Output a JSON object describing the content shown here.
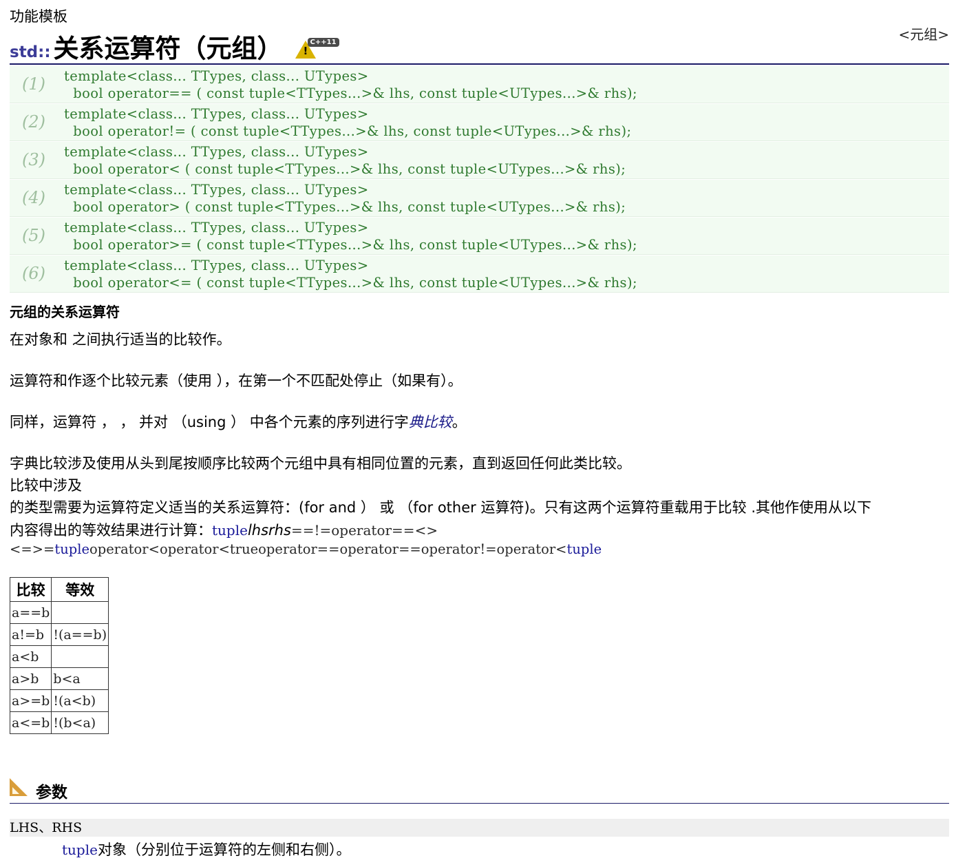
{
  "header": {
    "kind": "功能模板",
    "namespace": "std::",
    "name": "关系运算符（元组）",
    "badge": "C++11",
    "link": "<元组>"
  },
  "declarations": [
    {
      "num": "(1)",
      "line1": "template<class... TTypes, class... UTypes>",
      "line2": "  bool operator== ( const tuple<TTypes...>& lhs, const tuple<UTypes...>& rhs);"
    },
    {
      "num": "(2)",
      "line1": "template<class... TTypes, class... UTypes>",
      "line2": "  bool operator!= ( const tuple<TTypes...>& lhs, const tuple<UTypes...>& rhs);"
    },
    {
      "num": "(3)",
      "line1": "template<class... TTypes, class... UTypes>",
      "line2": "  bool operator< ( const tuple<TTypes...>& lhs, const tuple<UTypes...>& rhs);"
    },
    {
      "num": "(4)",
      "line1": "template<class... TTypes, class... UTypes>",
      "line2": "  bool operator> ( const tuple<TTypes...>& lhs, const tuple<UTypes...>& rhs);"
    },
    {
      "num": "(5)",
      "line1": "template<class... TTypes, class... UTypes>",
      "line2": "  bool operator>= ( const tuple<TTypes...>& lhs, const tuple<UTypes...>& rhs);"
    },
    {
      "num": "(6)",
      "line1": "template<class... TTypes, class... UTypes>",
      "line2": "  bool operator<= ( const tuple<TTypes...>& lhs, const tuple<UTypes...>& rhs);"
    }
  ],
  "description": {
    "heading": "元组的关系运算符",
    "p1": "在对象和 之间执行适当的比较作。",
    "p2": "运算符和作逐个比较元素（使用 ），在第一个不匹配处停止（如果有）。",
    "p3_before": "同样，运算符 ， ， 并对 （using ） 中各个元素的序列进行字",
    "p3_link": "典比较",
    "p3_after": "。",
    "p4": "字典比较涉及使用从头到尾按顺序比较两个元组中具有相同位置的元素，直到返回任何此类比较。",
    "p5": "比较中涉及",
    "p6": "的类型需要为运算符定义适当的关系运算符：(for and ） 或 （for other 运算符)。只有这两个运算符重载用于比较 .其他作使用从以下",
    "p7_text": "内容得出的等效结果进行计算：",
    "p7_kw": "tuple",
    "p7_italic": "lhsrhs",
    "p7_tail": "==!=operator==<>",
    "p8_a": "<=>=",
    "p8_kw1": "tuple",
    "p8_b": "operator<operator<",
    "p8_c": "trueoperator==operator==operator!=operator<",
    "p8_kw2": "tuple"
  },
  "table": {
    "headers": [
      "比较",
      "等效"
    ],
    "rows": [
      [
        "a==b",
        ""
      ],
      [
        "a!=b",
        "!(a==b)"
      ],
      [
        "a<b",
        ""
      ],
      [
        "a>b",
        "b<a"
      ],
      [
        "a>=b",
        "!(a<b)"
      ],
      [
        "a<=b",
        "!(b<a)"
      ]
    ]
  },
  "parameters": {
    "section_label": "参数",
    "section_icon": "set-square-icon",
    "name": "LHS、RHS",
    "desc_kw": "tuple",
    "desc_text": "对象（分别位于运算符的左侧和右侧）。"
  }
}
